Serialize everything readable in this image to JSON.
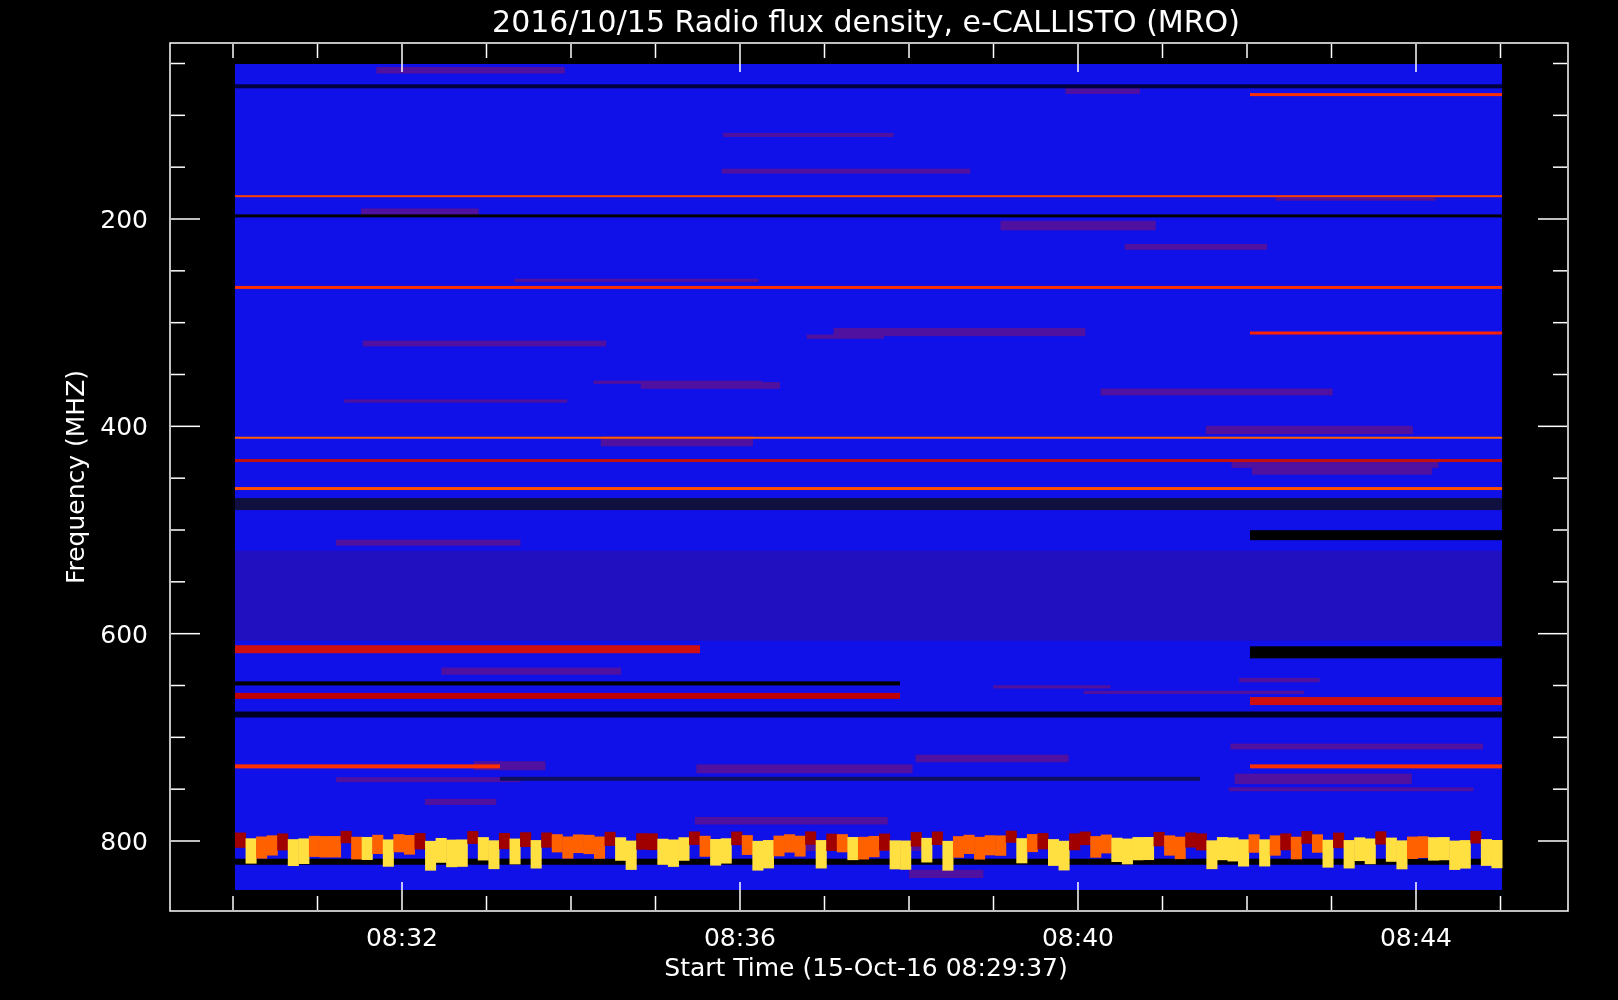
{
  "plot": {
    "title": "2016/10/15  Radio flux density, e-CALLISTO (MRO)",
    "xlabel": "Start Time (15-Oct-16 08:29:37)",
    "ylabel": "Frequency (MHZ)",
    "yticks": [
      "200",
      "400",
      "600",
      "800"
    ],
    "xticks": [
      "08:32",
      "08:36",
      "08:40",
      "08:44"
    ]
  }
}
